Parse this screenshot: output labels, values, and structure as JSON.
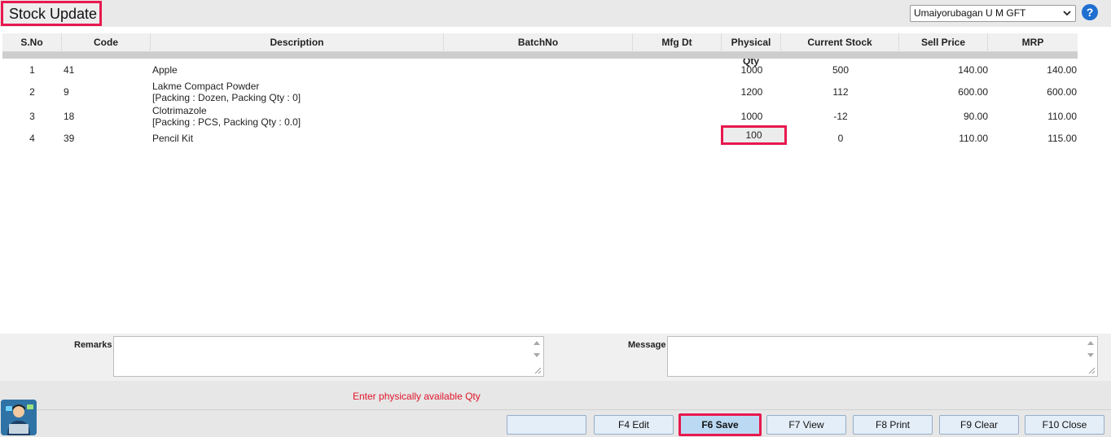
{
  "header": {
    "title": "Stock Update",
    "branch_selected": "Umaiyorubagan U M GFT",
    "help_label": "?"
  },
  "table": {
    "columns": [
      "S.No",
      "Code",
      "Description",
      "BatchNo",
      "Mfg Dt",
      "Physical Qty",
      "Current Stock",
      "Sell Price",
      "MRP"
    ],
    "rows": [
      {
        "sno": "1",
        "code": "41",
        "desc": "Apple",
        "desc2": "",
        "phys": "1000",
        "cur": "500",
        "sell": "140.00",
        "mrp": "140.00"
      },
      {
        "sno": "2",
        "code": "9",
        "desc": "Lakme Compact Powder",
        "desc2": "[Packing : Dozen, Packing Qty : 0]",
        "phys": "1200",
        "cur": "112",
        "sell": "600.00",
        "mrp": "600.00"
      },
      {
        "sno": "3",
        "code": "18",
        "desc": "Clotrimazole",
        "desc2": "[Packing : PCS, Packing Qty : 0.0]",
        "phys": "1000",
        "cur": "-12",
        "sell": "90.00",
        "mrp": "110.00"
      },
      {
        "sno": "4",
        "code": "39",
        "desc": "Pencil Kit",
        "desc2": "",
        "phys": "100",
        "cur": "0",
        "sell": "110.00",
        "mrp": "115.00"
      }
    ]
  },
  "footer": {
    "remarks_label": "Remarks",
    "message_label": "Message",
    "hint": "Enter physically available Qty"
  },
  "buttons": {
    "blank": "",
    "edit": "F4 Edit",
    "save": "F6 Save",
    "view": "F7 View",
    "print": "F8 Print",
    "clear": "F9 Clear",
    "close": "F10 Close"
  },
  "colors": {
    "highlight": "#e8184f",
    "hint_text": "#e0142a",
    "help_blue": "#1f6fd1"
  }
}
